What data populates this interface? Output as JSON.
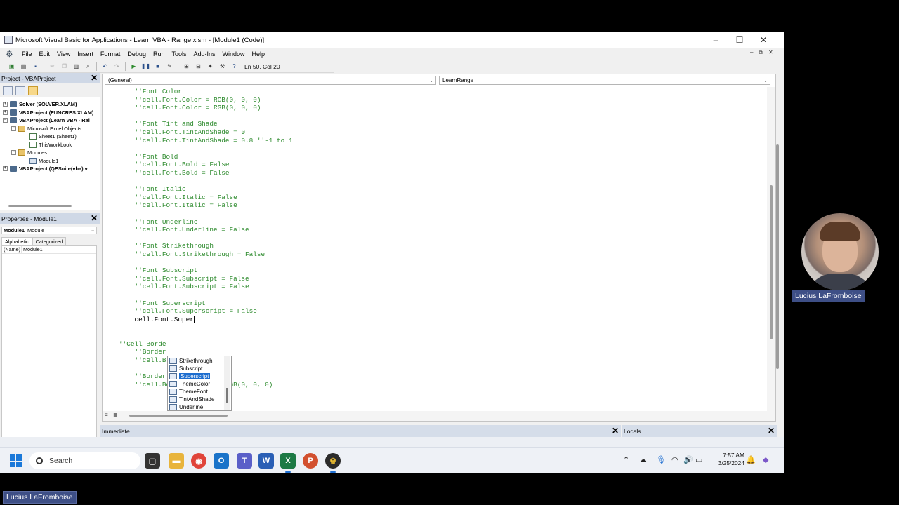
{
  "window": {
    "title": "Microsoft Visual Basic for Applications - Learn VBA - Range.xlsm - [Module1 (Code)]",
    "minimize": "–",
    "maximize": "☐",
    "close": "✕"
  },
  "menu": [
    "File",
    "Edit",
    "View",
    "Insert",
    "Format",
    "Debug",
    "Run",
    "Tools",
    "Add-Ins",
    "Window",
    "Help"
  ],
  "toolbar": {
    "status": "Ln 50, Col 20"
  },
  "project": {
    "title": "Project - VBAProject",
    "items": [
      {
        "label": "Solver (SOLVER.XLAM)",
        "bold": true
      },
      {
        "label": "VBAProject (FUNCRES.XLAM)",
        "bold": true
      },
      {
        "label": "VBAProject (Learn VBA - Rai",
        "bold": true
      },
      {
        "label": "Microsoft Excel Objects",
        "bold": false
      },
      {
        "label": "Sheet1 (Sheet1)",
        "bold": false
      },
      {
        "label": "ThisWorkbook",
        "bold": false
      },
      {
        "label": "Modules",
        "bold": false
      },
      {
        "label": "Module1",
        "bold": false
      },
      {
        "label": "VBAProject (QESuite(vba) v.",
        "bold": true
      }
    ]
  },
  "properties": {
    "title": "Properties - Module1",
    "object_name": "Module1",
    "object_type": "Module",
    "tabs": [
      "Alphabetic",
      "Categorized"
    ],
    "row_key": "(Name)",
    "row_value": "Module1"
  },
  "code": {
    "object_combo": "(General)",
    "procedure_combo": "LearnRange",
    "lines": [
      {
        "text": "    ''Font Color",
        "type": "comment"
      },
      {
        "text": "    ''cell.Font.Color = RGB(0, 0, 0)",
        "type": "comment"
      },
      {
        "text": "    ''cell.Font.Color = RGB(0, 0, 0)",
        "type": "comment"
      },
      {
        "text": "",
        "type": "plain"
      },
      {
        "text": "    ''Font Tint and Shade",
        "type": "comment"
      },
      {
        "text": "    ''cell.Font.TintAndShade = 0",
        "type": "comment"
      },
      {
        "text": "    ''cell.Font.TintAndShade = 0.8 ''-1 to 1",
        "type": "comment"
      },
      {
        "text": "",
        "type": "plain"
      },
      {
        "text": "    ''Font Bold",
        "type": "comment"
      },
      {
        "text": "    ''cell.Font.Bold = False",
        "type": "comment"
      },
      {
        "text": "    ''cell.Font.Bold = False",
        "type": "comment"
      },
      {
        "text": "",
        "type": "plain"
      },
      {
        "text": "    ''Font Italic",
        "type": "comment"
      },
      {
        "text": "    ''cell.Font.Italic = False",
        "type": "comment"
      },
      {
        "text": "    ''cell.Font.Italic = False",
        "type": "comment"
      },
      {
        "text": "",
        "type": "plain"
      },
      {
        "text": "    ''Font Underline",
        "type": "comment"
      },
      {
        "text": "    ''cell.Font.Underline = False",
        "type": "comment"
      },
      {
        "text": "",
        "type": "plain"
      },
      {
        "text": "    ''Font Strikethrough",
        "type": "comment"
      },
      {
        "text": "    ''cell.Font.Strikethrough = False",
        "type": "comment"
      },
      {
        "text": "",
        "type": "plain"
      },
      {
        "text": "    ''Font Subscript",
        "type": "comment"
      },
      {
        "text": "    ''cell.Font.Subscript = False",
        "type": "comment"
      },
      {
        "text": "    ''cell.Font.Subscript = False",
        "type": "comment"
      },
      {
        "text": "",
        "type": "plain"
      },
      {
        "text": "    ''Font Superscript",
        "type": "comment"
      },
      {
        "text": "    ''cell.Font.Superscript = False",
        "type": "comment"
      },
      {
        "text": "    cell.Font.Super",
        "type": "plain"
      },
      {
        "text": "",
        "type": "plain"
      },
      {
        "text": "",
        "type": "plain"
      },
      {
        "text": "''Cell Borde",
        "type": "comment"
      },
      {
        "text": "    ''Border",
        "type": "comment"
      },
      {
        "text": "    ''cell.B          r = 2",
        "type": "comment"
      },
      {
        "text": "",
        "type": "plain"
      },
      {
        "text": "    ''Border Color",
        "type": "comment"
      },
      {
        "text": "    ''cell.Borders.Color = RGB(0, 0, 0)",
        "type": "comment"
      }
    ]
  },
  "intellisense": {
    "items": [
      "Strikethrough",
      "Subscript",
      "Superscript",
      "ThemeColor",
      "ThemeFont",
      "TintAndShade",
      "Underline"
    ],
    "selected": "Superscript"
  },
  "panels": {
    "immediate": "Immediate",
    "locals": "Locals"
  },
  "taskbar": {
    "search": "Search",
    "time": "7:57 AM",
    "date": "3/25/2024"
  },
  "presenter": {
    "name": "Lucius LaFromboise"
  },
  "colors": {
    "comment": "#2e8b2e",
    "selection": "#1e6ecf",
    "name_tag": "#3e4f86"
  }
}
